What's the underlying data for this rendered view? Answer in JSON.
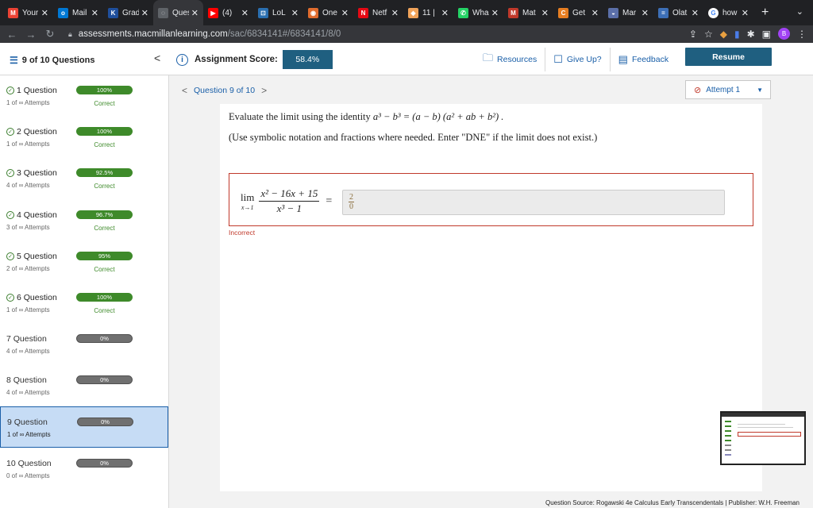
{
  "browser": {
    "tabs": [
      {
        "label": "Your",
        "icon": "gmail-icon",
        "color": "#ea4335",
        "glyph": "M"
      },
      {
        "label": "Mail",
        "icon": "outlook-icon",
        "color": "#0078d4",
        "glyph": "o"
      },
      {
        "label": "Grad",
        "icon": "grades-icon",
        "color": "#1f4f9c",
        "glyph": "K"
      },
      {
        "label": "Ques",
        "icon": "question-tab-icon",
        "color": "#5f6368",
        "glyph": "◌",
        "active": true
      },
      {
        "label": "(4)",
        "icon": "youtube-icon",
        "color": "#ff0000",
        "glyph": "▶"
      },
      {
        "label": "LoL",
        "icon": "lol-icon",
        "color": "#2a6fb0",
        "glyph": "⊡"
      },
      {
        "label": "One",
        "icon": "onetab-icon",
        "color": "#e06c2e",
        "glyph": "◉"
      },
      {
        "label": "Netf",
        "icon": "netflix-icon",
        "color": "#e50914",
        "glyph": "N"
      },
      {
        "label": "11 |",
        "icon": "cake-icon",
        "color": "#f0a35a",
        "glyph": "◆"
      },
      {
        "label": "Wha",
        "icon": "whatsapp-icon",
        "color": "#25d366",
        "glyph": "✆"
      },
      {
        "label": "Mat",
        "icon": "mathway-icon",
        "color": "#c0392b",
        "glyph": "M"
      },
      {
        "label": "Get",
        "icon": "chegg-icon",
        "color": "#e67e22",
        "glyph": "C"
      },
      {
        "label": "Mar",
        "icon": "marvel-icon",
        "color": "#5b6fa8",
        "glyph": "◒"
      },
      {
        "label": "Olat",
        "icon": "olat-icon",
        "color": "#3d6fb6",
        "glyph": "="
      },
      {
        "label": "how",
        "icon": "google-icon",
        "color": "#ffffff",
        "glyph": "G"
      }
    ],
    "new_tab": "+",
    "tab_menu": "⌄",
    "url_host": "assessments.macmillanlearning.com",
    "url_path": "/sac/6834141#/6834141/8/0",
    "profile_initial": "B"
  },
  "header": {
    "question_count": "9 of 10 Questions",
    "collapse": "<",
    "score_label": "Assignment Score:",
    "score_value": "58.4%",
    "resources": "Resources",
    "give_up": "Give Up?",
    "feedback": "Feedback",
    "resume": "Resume"
  },
  "questions": [
    {
      "title": "1 Question",
      "attempts": "1 of ∞ Attempts",
      "progress": "100%",
      "percent": 100,
      "status": "Correct",
      "done": true
    },
    {
      "title": "2 Question",
      "attempts": "1 of ∞ Attempts",
      "progress": "100%",
      "percent": 100,
      "status": "Correct",
      "done": true
    },
    {
      "title": "3 Question",
      "attempts": "4 of ∞ Attempts",
      "progress": "92.5%",
      "percent": 92.5,
      "status": "Correct",
      "done": true
    },
    {
      "title": "4 Question",
      "attempts": "3 of ∞ Attempts",
      "progress": "96.7%",
      "percent": 96.7,
      "status": "Correct",
      "done": true
    },
    {
      "title": "5 Question",
      "attempts": "2 of ∞ Attempts",
      "progress": "95%",
      "percent": 95,
      "status": "Correct",
      "done": true
    },
    {
      "title": "6 Question",
      "attempts": "1 of ∞ Attempts",
      "progress": "100%",
      "percent": 100,
      "status": "Correct",
      "done": true
    },
    {
      "title": "7 Question",
      "attempts": "4 of ∞ Attempts",
      "progress": "0%",
      "percent": 0,
      "status": "",
      "done": false
    },
    {
      "title": "8 Question",
      "attempts": "4 of ∞ Attempts",
      "progress": "0%",
      "percent": 0,
      "status": "",
      "done": false
    },
    {
      "title": "9 Question",
      "attempts": "1 of ∞ Attempts",
      "progress": "0%",
      "percent": 0,
      "status": "",
      "done": false,
      "selected": true
    },
    {
      "title": "10 Question",
      "attempts": "0 of ∞ Attempts",
      "progress": "0%",
      "percent": 0,
      "status": "",
      "done": false
    }
  ],
  "main": {
    "question_nav": "Question 9 of 10",
    "attempt": "Attempt 1",
    "prompt_text": "Evaluate the limit using the identity",
    "identity": "a³ − b³ = (a − b) (a² + ab + b²) .",
    "hint": "(Use symbolic notation and fractions where needed. Enter \"DNE\" if the limit does not exist.)",
    "lim_word": "lim",
    "lim_sub": "x→1",
    "numerator": "x² − 16x + 15",
    "denominator": "x³ − 1",
    "equals": "=",
    "answer_num": "2",
    "answer_den": "0",
    "feedback_status": "Incorrect"
  },
  "footer": {
    "source": "Question Source: Rogawski 4e Calculus Early Transcendentals  |  Publisher: W.H. Freeman"
  },
  "colors": {
    "primary": "#1f5f80",
    "link": "#1a5fa8",
    "correct": "#3e8a2a",
    "error": "#c0392b",
    "selected_bg": "#c6dcf5"
  }
}
